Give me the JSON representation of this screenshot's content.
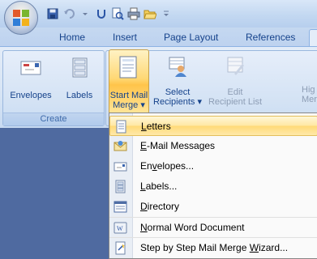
{
  "tabs": [
    "Home",
    "Insert",
    "Page Layout",
    "References"
  ],
  "ribbon": {
    "create_group": {
      "label": "Create",
      "envelopes": "Envelopes",
      "labels": "Labels"
    },
    "start_mail_merge": {
      "line1": "Start Mail",
      "line2": "Merge ▾"
    },
    "select_recipients": {
      "line1": "Select",
      "line2": "Recipients ▾"
    },
    "edit_recipient_list": {
      "line1": "Edit",
      "line2": "Recipient List"
    },
    "cut_right": {
      "line1": "Hig",
      "line2": "Merg"
    }
  },
  "menu": {
    "items": [
      {
        "pre": "",
        "key": "L",
        "post": "etters",
        "icon": "letter-icon",
        "highlighted": true
      },
      {
        "pre": "",
        "key": "E",
        "post": "-Mail Messages",
        "icon": "email-icon",
        "highlighted": false
      },
      {
        "pre": "En",
        "key": "v",
        "post": "elopes...",
        "icon": "envelope-icon",
        "highlighted": false
      },
      {
        "pre": "",
        "key": "L",
        "post": "abels...",
        "icon": "labels-icon",
        "highlighted": false
      },
      {
        "pre": "",
        "key": "D",
        "post": "irectory",
        "icon": "directory-icon",
        "highlighted": false
      },
      {
        "pre": "",
        "key": "N",
        "post": "ormal Word Document",
        "icon": "normal-document-icon",
        "highlighted": false
      },
      {
        "pre": "Step by Step Mail Merge ",
        "key": "W",
        "post": "izard...",
        "icon": "wizard-icon",
        "highlighted": false
      }
    ]
  }
}
